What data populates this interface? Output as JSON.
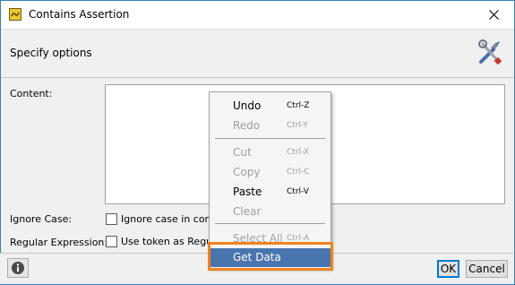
{
  "window": {
    "title": "Contains Assertion"
  },
  "header": {
    "title": "Specify options"
  },
  "icons": {
    "app": "soapui-icon",
    "close": "close-icon",
    "tools": "tools-icon",
    "info": "info-icon"
  },
  "form": {
    "content_label": "Content:",
    "content_value": "",
    "ignore_case_label": "Ignore Case:",
    "ignore_case_checkbox": "Ignore case in com",
    "ignore_case_checked": false,
    "regex_label": "Regular Expression:",
    "regex_checkbox": "Use token as Regul",
    "regex_checked": false
  },
  "footer": {
    "ok_label": "OK",
    "cancel_label": "Cancel"
  },
  "context_menu": {
    "items": [
      {
        "label": "Undo",
        "shortcut": "Ctrl-Z",
        "enabled": true
      },
      {
        "label": "Redo",
        "shortcut": "Ctrl-Y",
        "enabled": false
      },
      {
        "label": "Cut",
        "shortcut": "Ctrl-X",
        "enabled": false
      },
      {
        "label": "Copy",
        "shortcut": "Ctrl-C",
        "enabled": false
      },
      {
        "label": "Paste",
        "shortcut": "Ctrl-V",
        "enabled": true
      },
      {
        "label": "Clear",
        "shortcut": "",
        "enabled": false
      },
      {
        "label": "Select All",
        "shortcut": "Ctrl-A",
        "enabled": false
      },
      {
        "label": "Get Data",
        "shortcut": "",
        "enabled": true,
        "highlighted": true
      }
    ]
  },
  "colors": {
    "highlight": "#4a76b0",
    "callout_border": "#f0831c",
    "window_border": "#3c7fb1"
  }
}
